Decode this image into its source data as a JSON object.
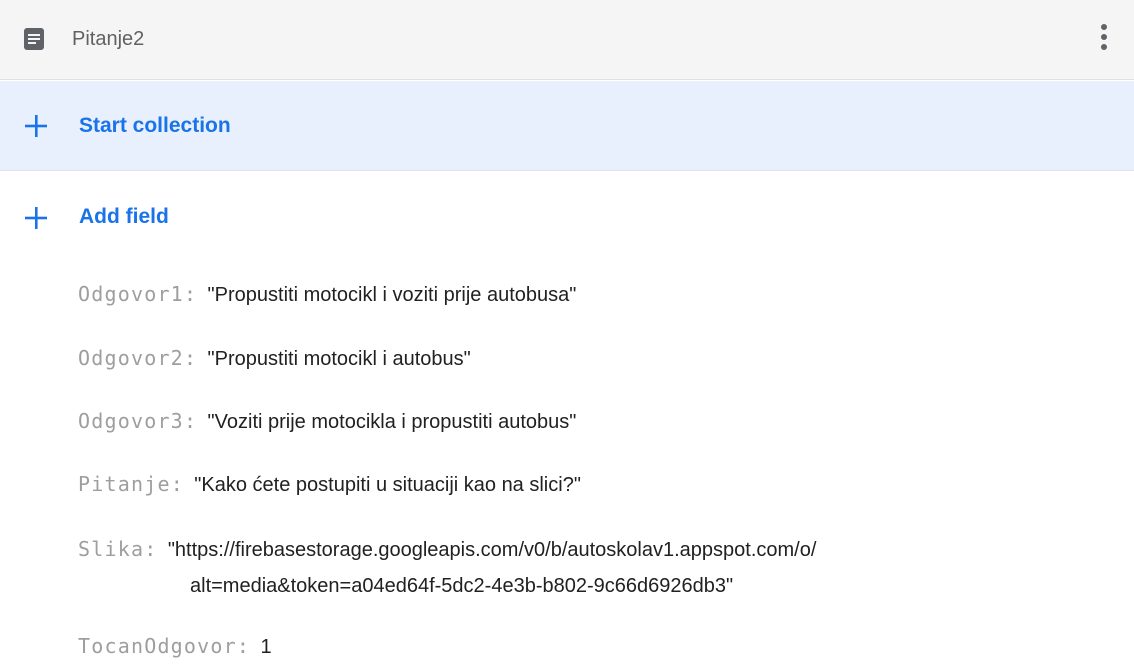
{
  "header": {
    "title": "Pitanje2",
    "doc_icon": "document-icon",
    "more_icon": "more-vert-icon"
  },
  "actions": {
    "start_collection": "Start collection",
    "add_field": "Add field",
    "plus_icon": "plus-icon"
  },
  "fields": [
    {
      "key": "Odgovor1",
      "value": "\"Propustiti motocikl i voziti prije autobusa\""
    },
    {
      "key": "Odgovor2",
      "value": "\"Propustiti motocikl i autobus\""
    },
    {
      "key": "Odgovor3",
      "value": "\"Voziti prije motocikla i propustiti autobus\""
    },
    {
      "key": "Pitanje",
      "value": "\"Kako ćete postupiti u situaciji kao na slici?\""
    },
    {
      "key": "Slika",
      "value_line1": "\"https://firebasestorage.googleapis.com/v0/b/autoskolav1.appspot.com/o/",
      "value_line2": "alt=media&token=a04ed64f-5dc2-4e3b-b802-9c66d6926db3\""
    },
    {
      "key": "TocanOdgovor",
      "value": "1"
    }
  ],
  "colors": {
    "accent": "#1a73e8",
    "header_bg": "#f5f5f5",
    "highlight_bg": "#e8f0fe",
    "key_text": "#9e9e9e",
    "value_text": "#212121"
  }
}
